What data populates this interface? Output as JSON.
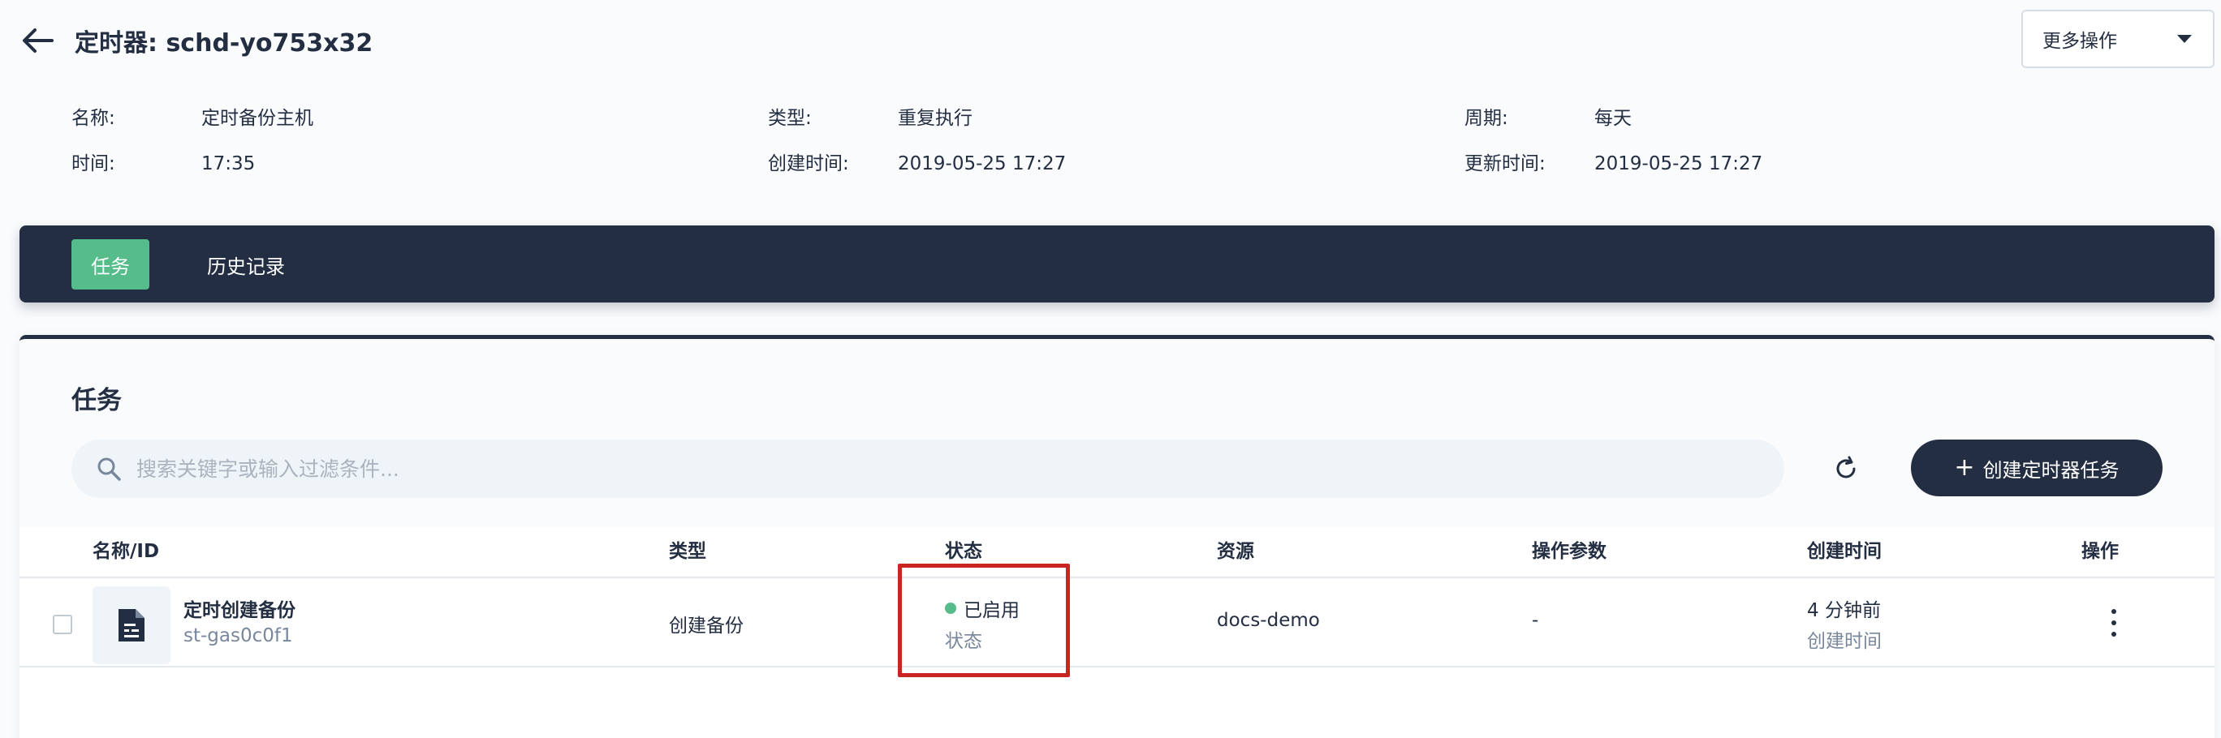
{
  "header": {
    "title": "定时器: schd-yo753x32",
    "back_icon": "arrow-left-icon",
    "more_actions_label": "更多操作"
  },
  "info": {
    "name_label": "名称:",
    "name_value": "定时备份主机",
    "type_label": "类型:",
    "type_value": "重复执行",
    "period_label": "周期:",
    "period_value": "每天",
    "time_label": "时间:",
    "time_value": "17:35",
    "created_label": "创建时间:",
    "created_value": "2019-05-25 17:27",
    "updated_label": "更新时间:",
    "updated_value": "2019-05-25 17:27"
  },
  "tabs": [
    {
      "label": "任务",
      "active": true
    },
    {
      "label": "历史记录",
      "active": false
    }
  ],
  "card": {
    "title": "任务",
    "search_placeholder": "搜索关键字或输入过滤条件...",
    "create_button": "创建定时器任务"
  },
  "table": {
    "columns": [
      "名称/ID",
      "类型",
      "状态",
      "资源",
      "操作参数",
      "创建时间",
      "操作"
    ],
    "rows": [
      {
        "name": "定时创建备份",
        "id": "st-gas0c0f1",
        "type": "创建备份",
        "status": "已启用",
        "status_sub": "状态",
        "resource": "docs-demo",
        "params": "-",
        "created": "4 分钟前",
        "created_sub": "创建时间"
      }
    ]
  },
  "colors": {
    "dark": "#242e42",
    "accent_green": "#55bc8a",
    "highlight_red": "#ca2621",
    "muted": "#79879c"
  }
}
